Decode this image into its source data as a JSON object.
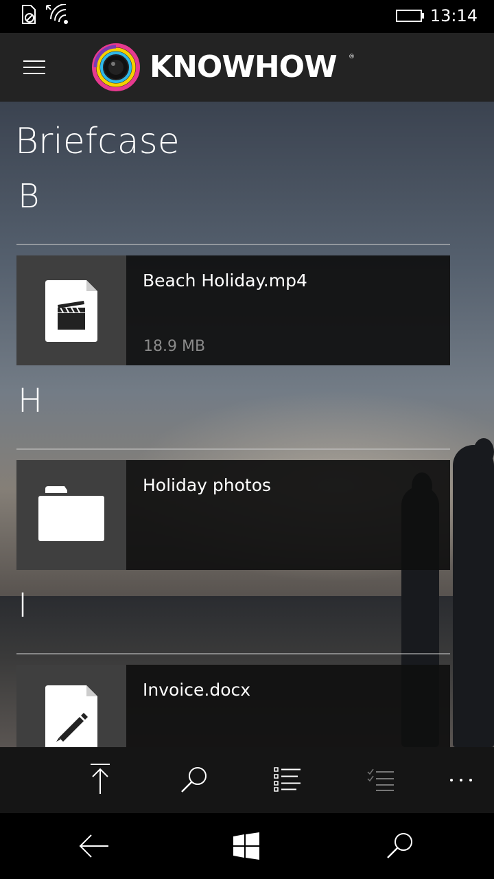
{
  "status_bar": {
    "time": "13:14"
  },
  "header": {
    "brand": "KNOWHOW",
    "brand_mark": "®"
  },
  "page": {
    "title": "Briefcase"
  },
  "groups": [
    {
      "letter": "B",
      "items": [
        {
          "name": "Beach Holiday.mp4",
          "size": "18.9 MB",
          "icon": "video-file-icon"
        }
      ]
    },
    {
      "letter": "H",
      "items": [
        {
          "name": "Holiday photos",
          "icon": "folder-icon"
        }
      ]
    },
    {
      "letter": "I",
      "items": [
        {
          "name": "Invoice.docx",
          "icon": "document-edit-icon"
        }
      ]
    }
  ],
  "app_bar": {
    "icons": [
      "upload-icon",
      "search-icon",
      "list-view-icon",
      "select-icon",
      "more-icon"
    ]
  },
  "nav_bar": {
    "icons": [
      "back-arrow-icon",
      "windows-start-icon",
      "search-icon"
    ]
  },
  "colors": {
    "header_bg": "#232323",
    "item_bg": "#0f0f0f",
    "thumb_bg": "#3f3f3f",
    "muted_text": "#8a8a8a"
  }
}
